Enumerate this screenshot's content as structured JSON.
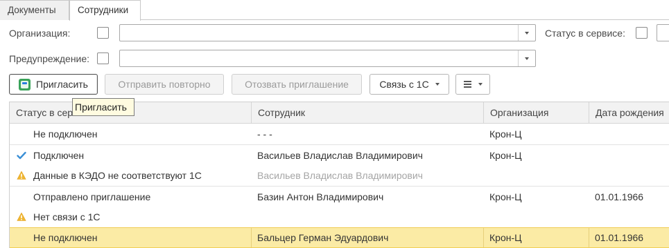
{
  "tabs": [
    {
      "label": "Документы",
      "active": false
    },
    {
      "label": "Сотрудники",
      "active": true
    }
  ],
  "filters": {
    "organization_label": "Организация:",
    "organization_value": "",
    "status_label": "Статус в сервисе:",
    "warning_label": "Предупреждение:",
    "warning_value": ""
  },
  "toolbar": {
    "invite_label": "Пригласить",
    "resend_label": "Отправить повторно",
    "revoke_label": "Отозвать приглашение",
    "link_label": "Связь с 1С"
  },
  "tooltip": {
    "text": "Пригласить"
  },
  "table": {
    "columns": [
      "Статус в сервисе",
      "Сотрудник",
      "Организация",
      "Дата рождения"
    ],
    "rows": [
      {
        "status": "Не подключен",
        "employee": "- - -",
        "org": "Крон-Ц",
        "birth": "",
        "icon": "none",
        "muted": false,
        "selected": false,
        "sep": false
      },
      {
        "status": "Подключен",
        "employee": "Васильев Владислав Владимирович",
        "org": "Крон-Ц",
        "birth": "",
        "icon": "check-icon",
        "muted": false,
        "selected": false,
        "sep": true
      },
      {
        "status": "Данные в КЭДО не соответствуют 1С",
        "employee": "Васильев Владислав Владимирович",
        "org": "",
        "birth": "",
        "icon": "warning-icon",
        "muted": true,
        "selected": false,
        "sep": false
      },
      {
        "status": "Отправлено приглашение",
        "employee": "Базин Антон Владимирович",
        "org": "Крон-Ц",
        "birth": "01.01.1966",
        "icon": "none",
        "muted": false,
        "selected": false,
        "sep": true
      },
      {
        "status": "Нет связи с 1С",
        "employee": "",
        "org": "",
        "birth": "",
        "icon": "warning-icon",
        "muted": false,
        "selected": false,
        "sep": false
      },
      {
        "status": "Не подключен",
        "employee": "Бальцер Герман Эдуардович",
        "org": "Крон-Ц",
        "birth": "01.01.1966",
        "icon": "none",
        "muted": false,
        "selected": true,
        "sep": false
      }
    ]
  },
  "colors": {
    "check": "#3a8fd6",
    "warning": "#f0b630",
    "selected_row": "#fbeba5"
  }
}
